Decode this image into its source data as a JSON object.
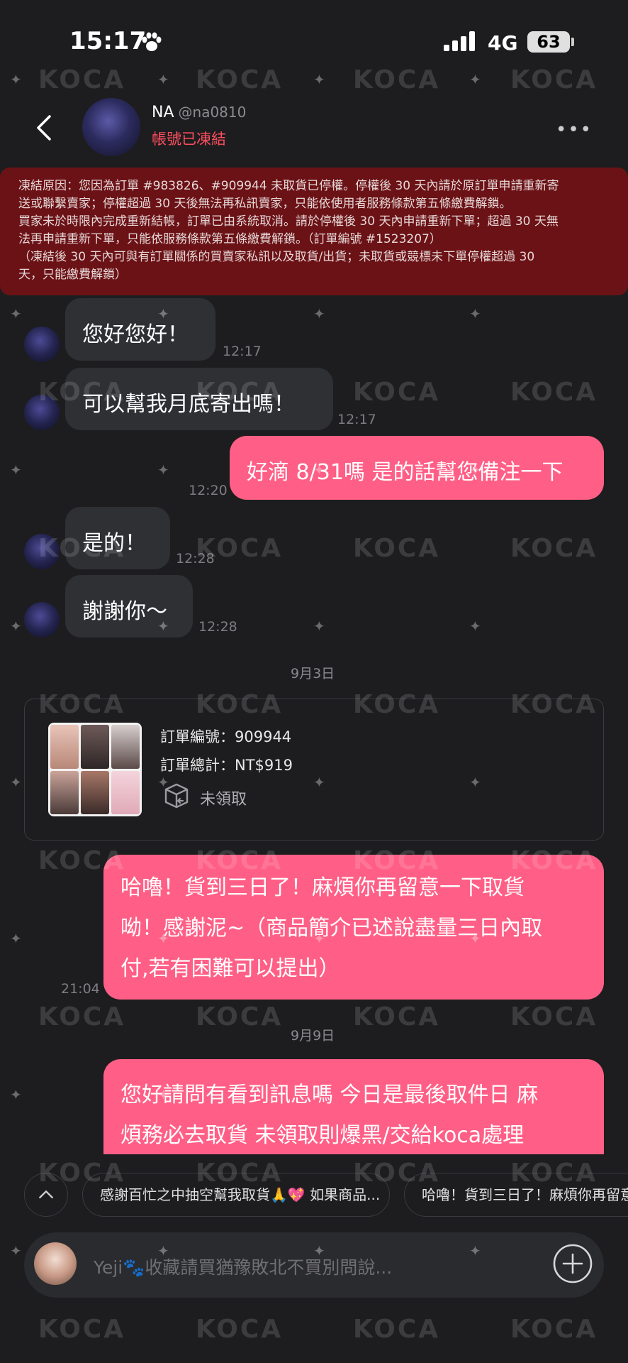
{
  "status_bar": {
    "time": "15:17",
    "network": "4G",
    "battery": "63"
  },
  "header": {
    "name": "NA",
    "handle": "@na0810",
    "status": "帳號已凍結"
  },
  "banner": {
    "lines": [
      "凍結原因：您因為訂單 #983826、#909944 未取貨已停權。停權後 30 天內請於原訂單申請重新寄",
      "送或聯繫賣家；停權超過 30 天後無法再私訊賣家，只能依使用者服務條款第五條繳費解鎖。",
      "買家未於時限內完成重新結帳，訂單已由系統取消。請於停權後 30 天內申請重新下單；超過 30 天無",
      "法再申請重新下單，只能依服務條款第五條繳費解鎖。（訂單編號 #1523207）",
      "（凍結後 30 天內可與有訂單關係的買賣家私訊以及取貨/出貨；未取貨或競標未下單停權超過 30",
      "天，只能繳費解鎖）"
    ]
  },
  "messages": [
    {
      "text": "您好您好！",
      "time": "12:17"
    },
    {
      "text": "可以幫我月底寄出嗎！",
      "time": "12:17"
    },
    {
      "text": "好滴 8/31嗎 是的話幫您備注一下",
      "time": "12:20"
    },
    {
      "text": "是的！",
      "time": "12:28"
    },
    {
      "text": "謝謝你～",
      "time": "12:28"
    },
    {
      "date": "9月3日"
    },
    {
      "lines": [
        "哈嚕！貨到三日了！麻煩你再留意一下取貨",
        "呦！感謝泥~（商品簡介已述說盡量三日內取",
        "付,若有困難可以提出）"
      ],
      "time": "21:04"
    },
    {
      "date": "9月9日"
    },
    {
      "lines": [
        "您好請問有看到訊息嗎 今日是最後取件日 麻",
        "煩務必去取貨 未領取則爆黑/交給koca處理"
      ]
    }
  ],
  "order": {
    "number_label": "訂單編號：909944",
    "total_label": "訂單總計：NT$919",
    "status": "未領取"
  },
  "quick_replies": [
    "感謝百忙之中抽空幫我取貨🙏💖 如果商品...",
    "哈嚕！貨到三日了！麻煩你再留意"
  ],
  "input": {
    "placeholder": "Yeji🐾收藏請買猶豫敗北不買別問說..."
  },
  "watermark": "KOCA"
}
